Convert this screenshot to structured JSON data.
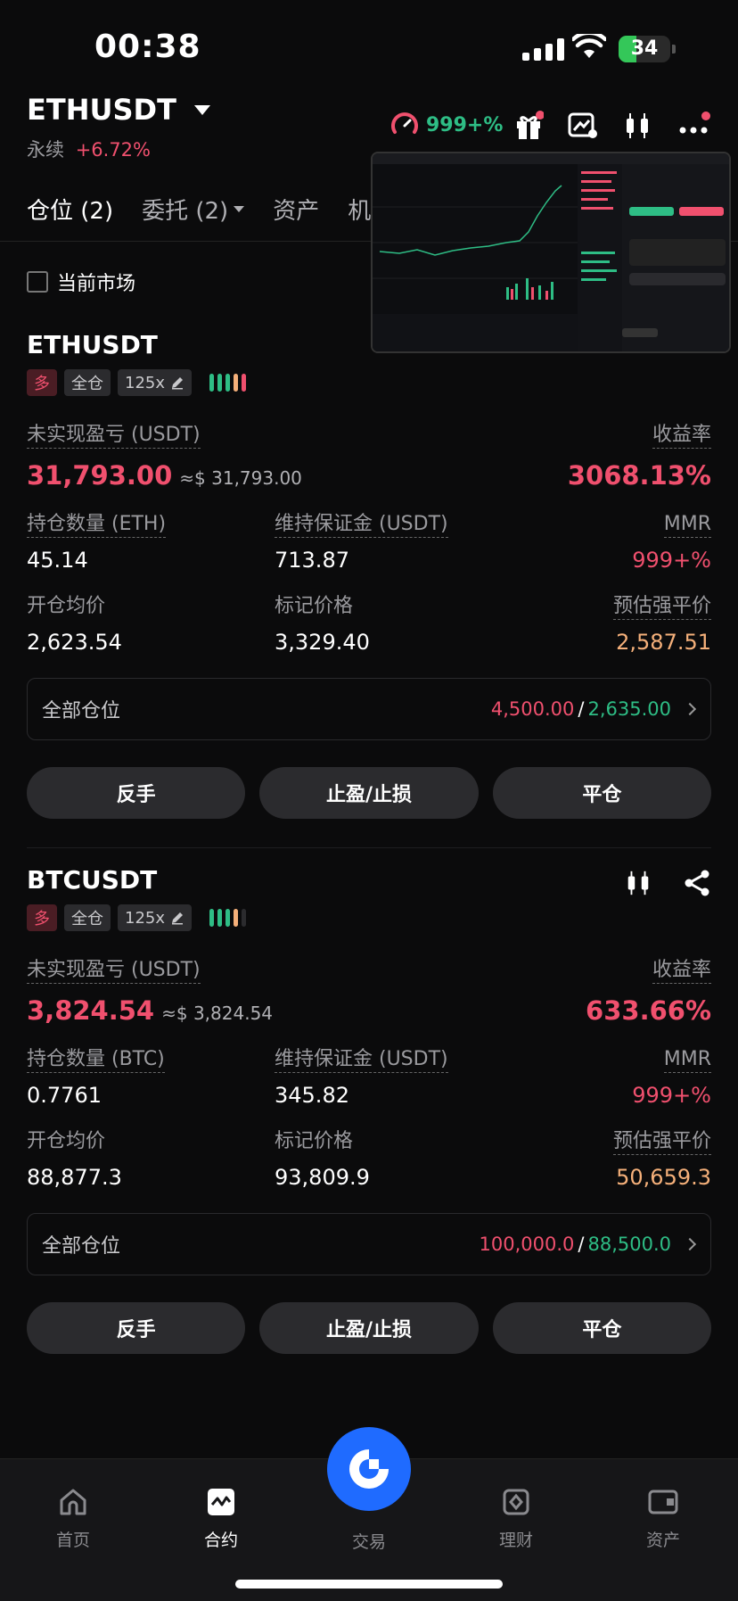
{
  "status_bar": {
    "time": "00:38",
    "battery": "34",
    "battery_fraction": 0.34
  },
  "header": {
    "pair": "ETHUSDT",
    "type": "永续",
    "change": "+6.72%",
    "gauge": "999+%"
  },
  "tabs": [
    {
      "label": "仓位 (2)"
    },
    {
      "label": "委托 (2)"
    },
    {
      "label": "资产"
    },
    {
      "label": "机"
    }
  ],
  "filter": {
    "label": "当前市场"
  },
  "positions": [
    {
      "symbol": "ETHUSDT",
      "side": "多",
      "margin_mode": "全仓",
      "leverage": "125x",
      "risk_bar_colors": [
        "#2ebd85",
        "#2ebd85",
        "#2ebd85",
        "#f5b07a",
        "#f0506e"
      ],
      "pnl_label": "未实现盈亏 (USDT)",
      "pnl": "31,793.00",
      "pnl_usd": "≈$ 31,793.00",
      "roe_label": "收益率",
      "roe": "3068.13%",
      "qty_label": "持仓数量 (ETH)",
      "qty": "45.14",
      "mm_label": "维持保证金 (USDT)",
      "mm": "713.87",
      "mmr_label": "MMR",
      "mmr": "999+%",
      "entry_label": "开仓均价",
      "entry": "2,623.54",
      "mark_label": "标记价格",
      "mark": "3,329.40",
      "liq_label": "预估强平价",
      "liq": "2,587.51",
      "all_label": "全部仓位",
      "tp": "4,500.00",
      "sl": "2,635.00",
      "btn_reverse": "反手",
      "btn_tpsl": "止盈/止损",
      "btn_close": "平仓"
    },
    {
      "symbol": "BTCUSDT",
      "side": "多",
      "margin_mode": "全仓",
      "leverage": "125x",
      "risk_bar_colors": [
        "#2ebd85",
        "#2ebd85",
        "#2ebd85",
        "#f5b07a",
        "#2b2b2e"
      ],
      "pnl_label": "未实现盈亏 (USDT)",
      "pnl": "3,824.54",
      "pnl_usd": "≈$ 3,824.54",
      "roe_label": "收益率",
      "roe": "633.66%",
      "qty_label": "持仓数量 (BTC)",
      "qty": "0.7761",
      "mm_label": "维持保证金 (USDT)",
      "mm": "345.82",
      "mmr_label": "MMR",
      "mmr": "999+%",
      "entry_label": "开仓均价",
      "entry": "88,877.3",
      "mark_label": "标记价格",
      "mark": "93,809.9",
      "liq_label": "预估强平价",
      "liq": "50,659.3",
      "all_label": "全部仓位",
      "tp": "100,000.0",
      "sl": "88,500.0",
      "btn_reverse": "反手",
      "btn_tpsl": "止盈/止损",
      "btn_close": "平仓"
    }
  ],
  "nav": [
    {
      "label": "首页"
    },
    {
      "label": "合约"
    },
    {
      "label": "交易"
    },
    {
      "label": "理财"
    },
    {
      "label": "资产"
    }
  ],
  "colors": {
    "up": "#2ebd85",
    "down": "#f0506e",
    "brand": "#1f6bff",
    "warning": "#f5b07a"
  }
}
